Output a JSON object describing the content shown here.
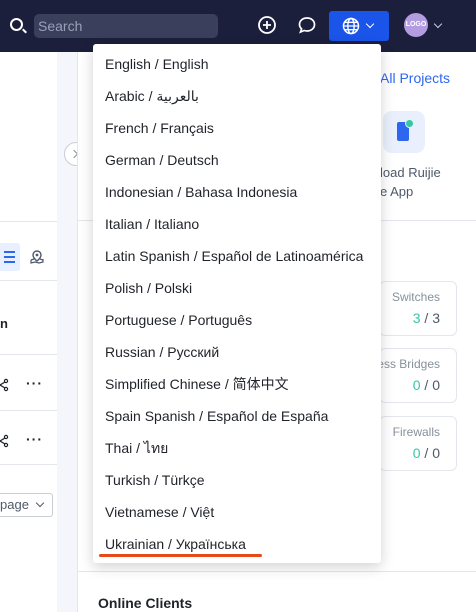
{
  "header": {
    "search_placeholder": "Search",
    "logo_text": "LOGO"
  },
  "main": {
    "all_projects": "All Projects",
    "app_line1": "load Ruijie",
    "app_line2": "e App",
    "stats": [
      {
        "label": "Switches",
        "value": "3",
        "total": "3"
      },
      {
        "label": "ess Bridges",
        "value": "0",
        "total": "0"
      },
      {
        "label": "Firewalls",
        "value": "0",
        "total": "0"
      }
    ],
    "online_clients": "Online Clients"
  },
  "left": {
    "column_head": "n",
    "pager_label": "page"
  },
  "language_menu": {
    "items": [
      "English / English",
      "Arabic / بالعربية",
      "French / Français",
      "German / Deutsch",
      "Indonesian / Bahasa Indonesia",
      "Italian / Italiano",
      "Latin Spanish / Español de Latinoamérica",
      "Polish / Polski",
      "Portuguese / Português",
      "Russian / Русский",
      "Simplified Chinese / 简体中文",
      "Spain Spanish / Español de España",
      "Thai / ไทย",
      "Turkish / Türkçe",
      "Vietnamese / Việt",
      "Ukrainian / Українська"
    ],
    "highlight_color": "#e64a19"
  },
  "colors": {
    "topbar": "#1b1f3b",
    "accent": "#1a54e8",
    "link": "#2d67f0",
    "stat_value": "#3ac4a8"
  }
}
